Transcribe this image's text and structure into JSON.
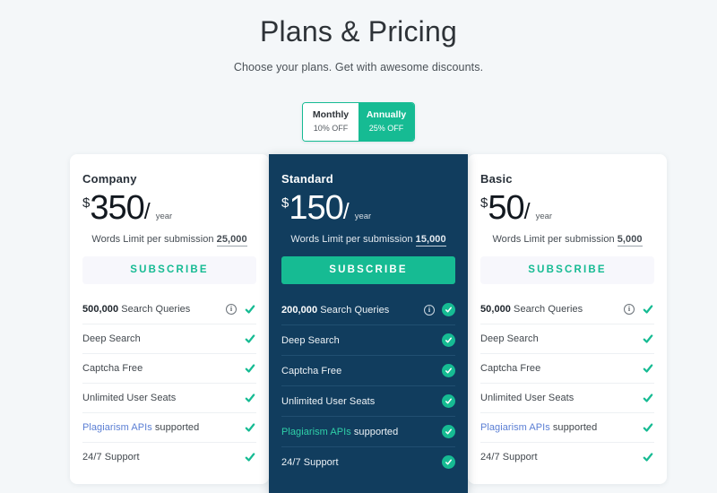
{
  "header": {
    "title": "Plans & Pricing",
    "subtitle": "Choose your plans. Get with awesome discounts."
  },
  "billing_toggle": {
    "monthly": {
      "label": "Monthly",
      "discount": "10% OFF",
      "active": false
    },
    "annually": {
      "label": "Annually",
      "discount": "25% OFF",
      "active": true
    }
  },
  "colors": {
    "accent_teal": "#16bb93",
    "featured_card": "#113d5e",
    "page_background": "#f4f7f9",
    "link_blue": "#5b7fd4",
    "link_teal": "#2fd0a8"
  },
  "plans": [
    {
      "name": "Company",
      "currency": "$",
      "amount": "350",
      "slash": "/",
      "period": "year",
      "words_limit_label": "Words Limit per submission",
      "words_limit_value": "25,000",
      "cta": "SUBSCRIBE",
      "featured": false,
      "features": [
        {
          "bold": "500,000",
          "text": " Search Queries",
          "info": true,
          "info_glyph": "i"
        },
        {
          "bold": "",
          "text": "Deep Search",
          "info": false
        },
        {
          "bold": "",
          "text": "Captcha Free",
          "info": false
        },
        {
          "bold": "",
          "text": "Unlimited User Seats",
          "info": false
        },
        {
          "bold": "",
          "link": "Plagiarism APIs",
          "text": " supported",
          "info": false
        },
        {
          "bold": "",
          "text": "24/7 Support",
          "info": false
        }
      ]
    },
    {
      "name": "Standard",
      "currency": "$",
      "amount": "150",
      "slash": "/",
      "period": "year",
      "words_limit_label": "Words Limit per submission",
      "words_limit_value": "15,000",
      "cta": "SUBSCRIBE",
      "featured": true,
      "features": [
        {
          "bold": "200,000",
          "text": " Search Queries",
          "info": true,
          "info_glyph": "i"
        },
        {
          "bold": "",
          "text": "Deep Search",
          "info": false
        },
        {
          "bold": "",
          "text": "Captcha Free",
          "info": false
        },
        {
          "bold": "",
          "text": "Unlimited User Seats",
          "info": false
        },
        {
          "bold": "",
          "link": "Plagiarism APIs",
          "text": " supported",
          "info": false
        },
        {
          "bold": "",
          "text": "24/7 Support",
          "info": false
        }
      ]
    },
    {
      "name": "Basic",
      "currency": "$",
      "amount": "50",
      "slash": "/",
      "period": "year",
      "words_limit_label": "Words Limit per submission",
      "words_limit_value": "5,000",
      "cta": "SUBSCRIBE",
      "featured": false,
      "features": [
        {
          "bold": "50,000",
          "text": " Search Queries",
          "info": true,
          "info_glyph": "i"
        },
        {
          "bold": "",
          "text": "Deep Search",
          "info": false
        },
        {
          "bold": "",
          "text": "Captcha Free",
          "info": false
        },
        {
          "bold": "",
          "text": "Unlimited User Seats",
          "info": false
        },
        {
          "bold": "",
          "link": "Plagiarism APIs",
          "text": " supported",
          "info": false
        },
        {
          "bold": "",
          "text": "24/7 Support",
          "info": false
        }
      ]
    }
  ]
}
